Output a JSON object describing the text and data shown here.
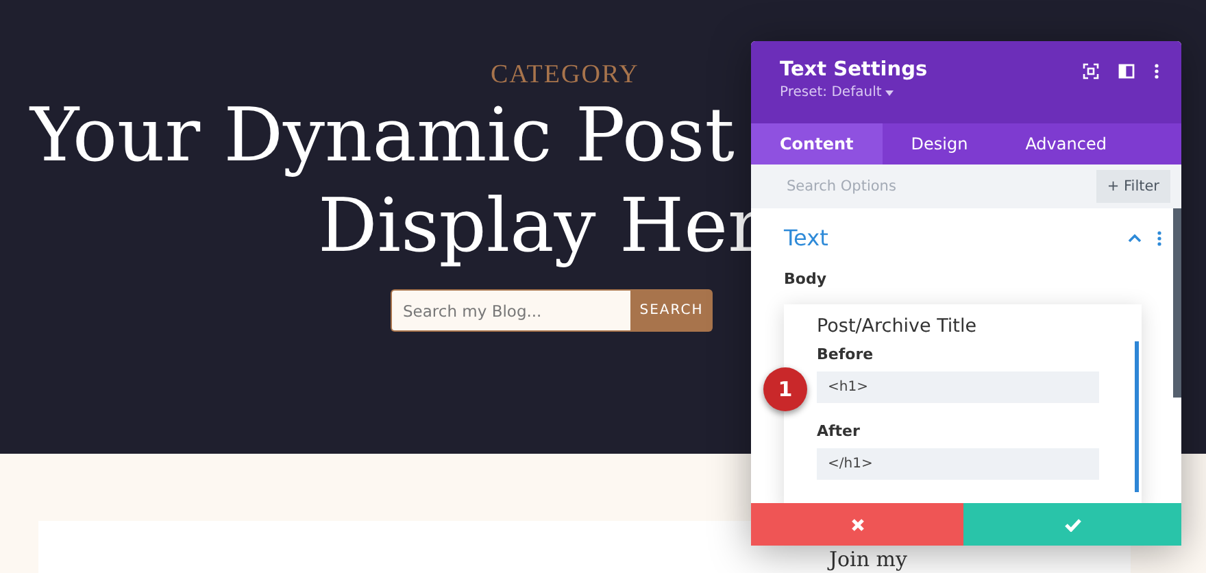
{
  "hero": {
    "category": "CATEGORY",
    "title_lines": [
      "Your Dynamic Post",
      "Display Her"
    ],
    "search": {
      "placeholder": "Search my Blog...",
      "button": "SEARCH"
    }
  },
  "content": {
    "heading": "Join my"
  },
  "panel": {
    "title": "Text Settings",
    "preset": "Preset: Default",
    "tabs": [
      {
        "label": "Content",
        "selected": true
      },
      {
        "label": "Design",
        "selected": false
      },
      {
        "label": "Advanced",
        "selected": false
      }
    ],
    "search": {
      "placeholder": "Search Options",
      "filter_button": "+ Filter"
    },
    "section": {
      "title": "Text",
      "expanded": true
    },
    "field_label": "Body",
    "popup": {
      "title": "Post/Archive Title",
      "fields": [
        {
          "label": "Before",
          "value": "<h1>"
        },
        {
          "label": "After",
          "value": "</h1>"
        }
      ]
    },
    "step_badge": "1"
  }
}
